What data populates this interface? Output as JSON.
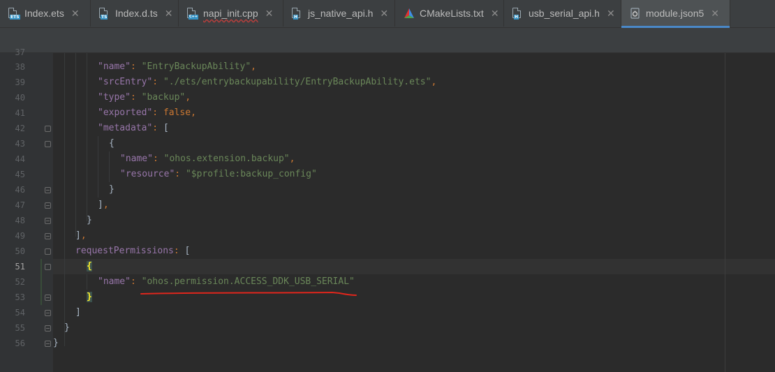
{
  "tabs": [
    {
      "label": "Index.ets",
      "icon": "ets-file-icon",
      "badge": "ETS",
      "badge_color": "#3592c4"
    },
    {
      "label": "Index.d.ts",
      "icon": "ts-file-icon",
      "badge": "TS",
      "badge_color": "#3592c4"
    },
    {
      "label": "napi_init.cpp",
      "icon": "cpp-file-icon",
      "badge": "C++",
      "badge_color": "#3592c4"
    },
    {
      "label": "js_native_api.h",
      "icon": "header-file-icon",
      "badge": "H",
      "badge_color": "#3592c4"
    },
    {
      "label": "CMakeLists.txt",
      "icon": "cmake-icon",
      "badge": "",
      "badge_color": ""
    },
    {
      "label": "usb_serial_api.h",
      "icon": "header-file-icon",
      "badge": "H",
      "badge_color": "#3592c4"
    },
    {
      "label": "module.json5",
      "icon": "json-file-icon",
      "badge": "",
      "badge_color": ""
    }
  ],
  "close_glyph": "✕",
  "active_tab": "module.json5",
  "line_numbers": [
    "37",
    "38",
    "39",
    "40",
    "41",
    "42",
    "43",
    "44",
    "45",
    "46",
    "47",
    "48",
    "49",
    "50",
    "51",
    "52",
    "53",
    "54",
    "55",
    "56"
  ],
  "code": {
    "l38_key": "\"name\"",
    "l38_val": "\"EntryBackupAbility\"",
    "l39_key": "\"srcEntry\"",
    "l39_val": "\"./ets/entrybackupability/EntryBackupAbility.ets\"",
    "l40_key": "\"type\"",
    "l40_val": "\"backup\"",
    "l41_key": "\"exported\"",
    "l41_val": "false",
    "l42_key": "\"metadata\"",
    "l42_val": "[",
    "l43": "{",
    "l44_key": "\"name\"",
    "l44_val": "\"ohos.extension.backup\"",
    "l45_key": "\"resource\"",
    "l45_val": "\"$profile:backup_config\"",
    "l46": "}",
    "l47": "]",
    "l48": "}",
    "l49": "]",
    "l50_key": "requestPermissions",
    "l50_val": "[",
    "l51": "{",
    "l52_key": "\"name\"",
    "l52_val": "\"ohos.permission.ACCESS_DDK_USB_SERIAL\"",
    "l53": "}",
    "l54": "]",
    "l55": "}",
    "l56": "}",
    "colon": ": ",
    "comma": ","
  },
  "colors": {
    "background": "#2b2b2b",
    "key": "#9876aa",
    "string": "#6a8759",
    "keyword": "#cc7832",
    "annotation_underline": "#e0261c"
  }
}
